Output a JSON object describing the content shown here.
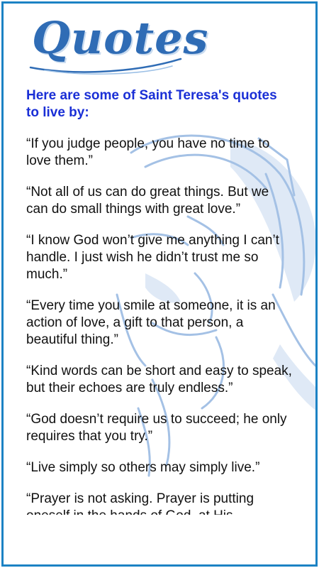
{
  "header": {
    "logo_text": "Quotes"
  },
  "intro": "Here are some of Saint Teresa's quotes to live by:",
  "quotes": [
    "“If you judge people, you have no time to love them.”",
    "“Not all of us can do great things. But we can do small things with great love.”",
    "“I know God won’t give me anything I can’t handle. I just wish he didn’t trust me so much.”",
    "“Every time you smile at someone, it is an action of love, a gift to that person, a beautiful thing.”",
    "“Kind words can be short and easy to speak, but their echoes are truly endless.”",
    "“God doesn’t require us to succeed; he only requires that you try.”",
    "“Live simply so others may simply live.”",
    "“Prayer is not asking. Prayer is putting oneself in the hands of God, at His"
  ],
  "colors": {
    "frame_border": "#1c82c4",
    "intro_text": "#1a2fd6",
    "logo": "#2f6cb5",
    "sketch": "#5b8fd0"
  }
}
